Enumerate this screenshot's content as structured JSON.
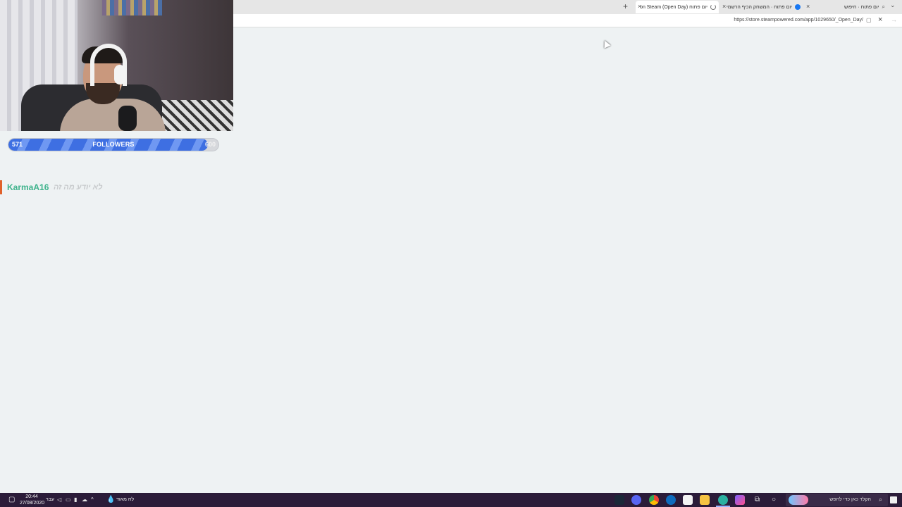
{
  "browser": {
    "tabs": [
      {
        "label": "יום פתוח · חיפוש",
        "icon": "search-icon",
        "active": false
      },
      {
        "label": "יום פתוח · המשחק הכיף הרשמי",
        "icon": "facebook-icon",
        "active": false
      },
      {
        "label": "יום פתוח (Open Day) on Steam",
        "icon": "loading-icon",
        "active": true
      }
    ],
    "tab_close_glyph": "×",
    "new_tab_glyph": "+",
    "tab_menu_glyph": "⌄",
    "url": "https://store.steampowered.com/app/1029650/_Open_Day/",
    "stop_glyph": "×",
    "forward_glyph": "→"
  },
  "overlay": {
    "followers": {
      "current": "571",
      "label": "FOLLOWERS",
      "goal": "600",
      "progress": 0.95
    },
    "chat": {
      "username": "KarmaA16",
      "message": "לא יודע מה זה",
      "username_color": "#3fb38c",
      "accent_color": "#e0612a"
    }
  },
  "taskbar": {
    "time": "20:44",
    "date": "27/08/2020",
    "language": "עבר",
    "weather_text": "לח מאוד",
    "search_placeholder": "הקלד כאן כדי לחפש",
    "pinned_icons": [
      "steam-icon",
      "discord-icon",
      "chrome-icon",
      "edge-icon",
      "store-icon",
      "file-explorer-icon",
      "browser-icon",
      "copilot-icon",
      "task-view-icon",
      "cortana-icon"
    ]
  },
  "colors": {
    "page_background": "#eef2f3",
    "taskbar": "#2b1c39",
    "progress_fill": "#3e6fe2"
  }
}
